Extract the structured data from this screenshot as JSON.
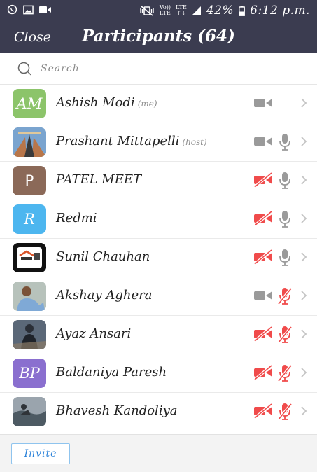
{
  "status_bar": {
    "volte": "Vo))",
    "lte_top": "LTE",
    "lte_bottom": "LTE",
    "battery": "42%",
    "time": "6:12 p.m."
  },
  "header": {
    "close_label": "Close",
    "title": "Participants (64)"
  },
  "search": {
    "placeholder": "Search"
  },
  "participants": [
    {
      "name": "Ashish Modi",
      "role": "(me)",
      "avatar_text": "AM",
      "avatar_color": "#8cc46a",
      "video": "on",
      "mic": "none"
    },
    {
      "name": "Prashant Mittapelli",
      "role": "(host)",
      "avatar_text": "",
      "avatar_color": "#6b8fb3",
      "video": "on",
      "mic": "on"
    },
    {
      "name": "PATEL MEET",
      "role": "",
      "avatar_text": "P",
      "avatar_color": "#8b6958",
      "video": "off",
      "mic": "on"
    },
    {
      "name": "Redmi",
      "role": "",
      "avatar_text": "R",
      "avatar_color": "#4db6ef",
      "video": "off",
      "mic": "on"
    },
    {
      "name": "Sunil Chauhan",
      "role": "",
      "avatar_text": "",
      "avatar_color": "#111111",
      "video": "off",
      "mic": "on"
    },
    {
      "name": "Akshay Aghera",
      "role": "",
      "avatar_text": "",
      "avatar_color": "#9aa6a0",
      "video": "on",
      "mic": "off"
    },
    {
      "name": "Ayaz Ansari",
      "role": "",
      "avatar_text": "",
      "avatar_color": "#3b4250",
      "video": "off",
      "mic": "off"
    },
    {
      "name": "Baldaniya Paresh",
      "role": "",
      "avatar_text": "BP",
      "avatar_color": "#8a6fcf",
      "video": "off",
      "mic": "off"
    },
    {
      "name": "Bhavesh Kandoliya",
      "role": "",
      "avatar_text": "",
      "avatar_color": "#7f8a92",
      "video": "off",
      "mic": "off"
    }
  ],
  "footer": {
    "invite_label": "Invite"
  },
  "colors": {
    "header_bg": "#3b3c50",
    "muted_red": "#f04b4b",
    "icon_gray": "#9a9a9a",
    "invite_blue": "#2b82d9"
  }
}
